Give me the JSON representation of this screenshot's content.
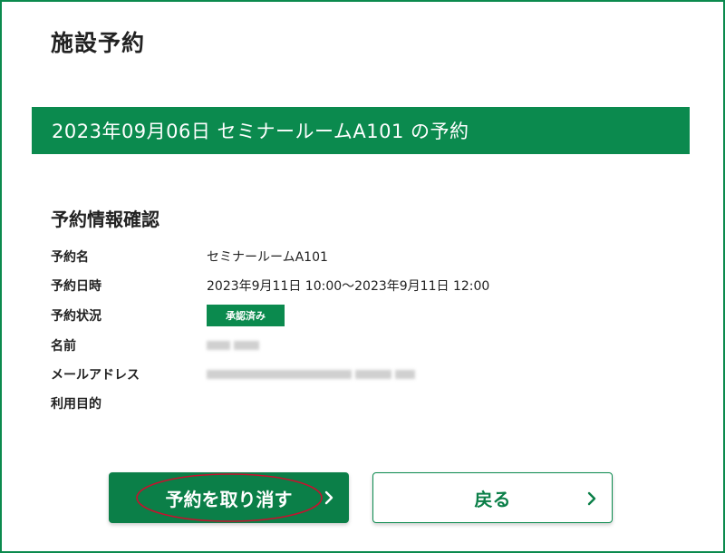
{
  "page": {
    "title": "施設予約"
  },
  "banner": {
    "text": "2023年09月06日  セミナールームA101 の予約"
  },
  "section": {
    "title": "予約情報確認"
  },
  "details": {
    "name_label": "予約名",
    "name_value": "セミナールームA101",
    "datetime_label": "予約日時",
    "datetime_value": "2023年9月11日 10:00～2023年9月11日 12:00",
    "status_label": "予約状況",
    "status_value": "承認済み",
    "person_label": "名前",
    "email_label": "メールアドレス",
    "purpose_label": "利用目的"
  },
  "buttons": {
    "cancel_label": "予約を取り消す",
    "back_label": "戻る"
  },
  "colors": {
    "brand_green": "#0b8a4e",
    "highlight_red": "#c8102e"
  },
  "icons": {
    "chevron": "chevron-right-icon"
  }
}
